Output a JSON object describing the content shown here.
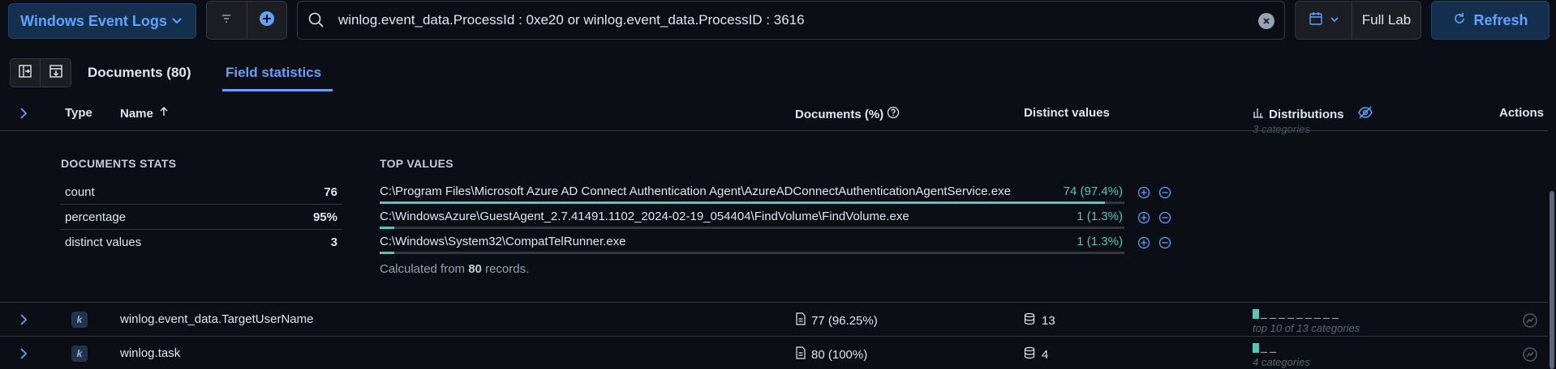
{
  "topbar": {
    "data_view_label": "Windows Event Logs",
    "query": "winlog.event_data.ProcessId : 0xe20 or winlog.event_data.ProcessID : 3616",
    "date_label": "Full Lab",
    "refresh_label": "Refresh"
  },
  "tabs": {
    "documents": "Documents (80)",
    "field_statistics": "Field statistics"
  },
  "table": {
    "headers": {
      "type": "Type",
      "name": "Name",
      "documents": "Documents (%)",
      "distinct": "Distinct values",
      "distributions": "Distributions",
      "actions": "Actions"
    }
  },
  "expanded": {
    "stats_title": "DOCUMENTS STATS",
    "top_values_title": "TOP VALUES",
    "stats": [
      {
        "label": "count",
        "value": "76"
      },
      {
        "label": "percentage",
        "value": "95%"
      },
      {
        "label": "distinct values",
        "value": "3"
      }
    ],
    "top_values": [
      {
        "path": "C:\\Program Files\\Microsoft Azure AD Connect Authentication Agent\\AzureADConnectAuthenticationAgentService.exe",
        "count": "74 (97.4%)",
        "fraction": 0.974
      },
      {
        "path": "C:\\WindowsAzure\\GuestAgent_2.7.41491.1102_2024-02-19_054404\\FindVolume\\FindVolume.exe",
        "count": "1 (1.3%)",
        "fraction": 0.013
      },
      {
        "path": "C:\\Windows\\System32\\CompatTelRunner.exe",
        "count": "1 (1.3%)",
        "fraction": 0.013
      }
    ],
    "calc_prefix": "Calculated from ",
    "calc_count": "80",
    "calc_suffix": " records."
  },
  "rows": [
    {
      "type": "k",
      "name": "winlog.event_data.TargetUserName",
      "docs": "77 (96.25%)",
      "distinct": "13",
      "categories": "top 10 of 13 categories"
    },
    {
      "type": "k",
      "name": "winlog.task",
      "docs": "80 (100%)",
      "distinct": "4",
      "categories": "4 categories"
    }
  ],
  "partial_above_categories": "3 categories",
  "colors": {
    "accent": "#61a2ff",
    "success": "#54c7b6",
    "background": "#0b0e14"
  }
}
